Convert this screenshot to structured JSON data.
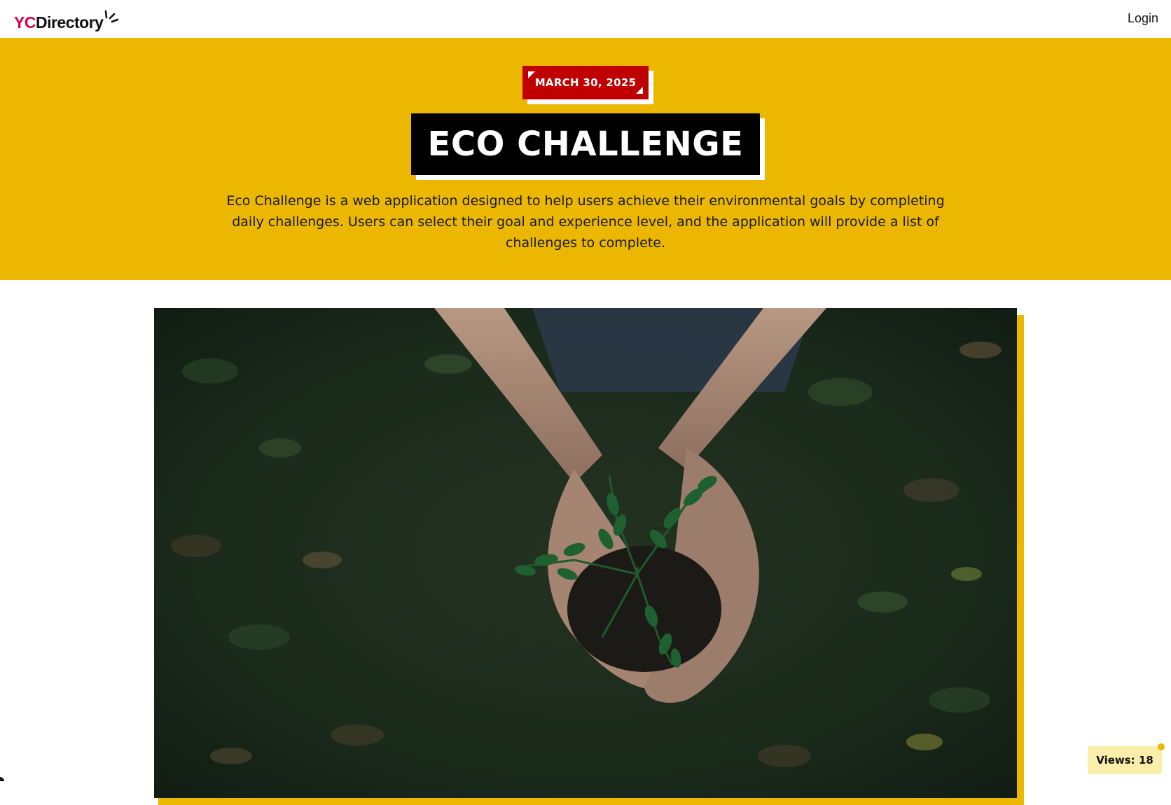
{
  "navbar": {
    "logo_prefix": "YC",
    "logo_suffix": "Directory",
    "login_label": "Login"
  },
  "startup": {
    "date": "MARCH 30, 2025",
    "title": "ECO CHALLENGE",
    "description": "Eco Challenge is a web application designed to help users achieve their environmental goals by completing daily challenges. Users can select their goal and experience level, and the application will provide a list of challenges to complete."
  },
  "image": {
    "subject": "hands holding soil with a green seedling"
  },
  "views": {
    "label": "Views: 18",
    "count": 18
  },
  "colors": {
    "primary_yellow": "#ebb700",
    "accent_red": "#c00000",
    "brand_pink": "#e0004d",
    "title_bg": "#000000",
    "views_badge_bg": "#fbeeaa"
  },
  "icons": {
    "logo_burst": "burst-icon"
  }
}
